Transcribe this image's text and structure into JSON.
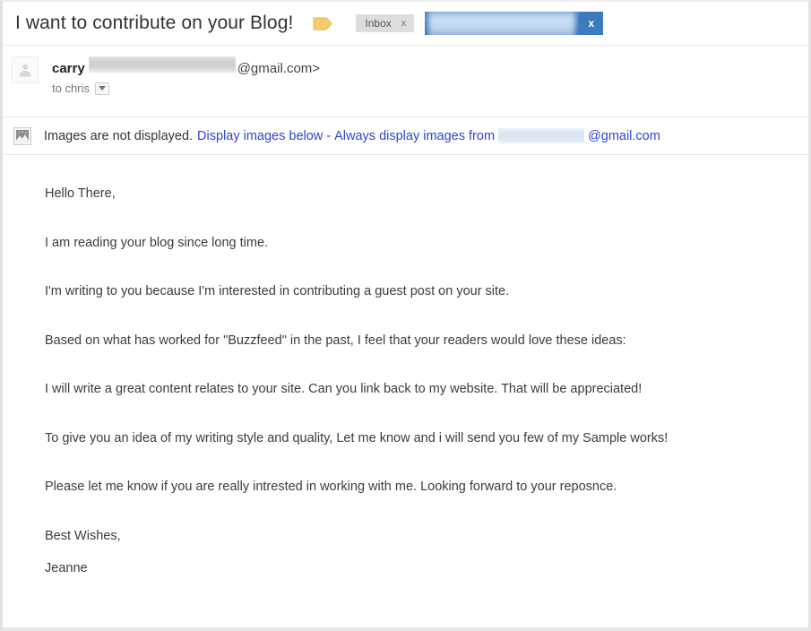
{
  "window": {
    "type": "email-message-view"
  },
  "colors": {
    "link_blue": "#2a47cf",
    "chip_blue": "#3d7cbc",
    "label_yellow": "#f5ce6b",
    "chip_gray": "#dddddd",
    "body_text": "#3c3c3c"
  },
  "header": {
    "subject": "I want to contribute on your Blog!",
    "label_icon": "label-tag-icon",
    "tags": [
      {
        "label": "Inbox",
        "remove_label": "x",
        "style": "gray"
      },
      {
        "label": "",
        "remove_label": "x",
        "style": "blue-redacted",
        "redacted": true
      }
    ]
  },
  "sender": {
    "avatar_icon": "user-avatar-icon",
    "name": "carry",
    "email_redacted": true,
    "email_domain": "@gmail.com>",
    "recipient": "to chris",
    "details_caret_icon": "chevron-down-icon"
  },
  "images_notice": {
    "icon": "broken-image-icon",
    "static_text": "Images are not displayed.",
    "display_link": "Display images below",
    "separator": "-",
    "always_link": "Always display images from",
    "address_redacted": true,
    "address_domain": "@gmail.com"
  },
  "body": {
    "paragraphs": [
      "Hello There,",
      "I am reading your blog since long time.",
      "I'm writing to you because I'm interested in contributing a guest post on your site.",
      "Based on what has worked for \"Buzzfeed\" in the past, I feel that your readers would love these ideas:",
      "I will write a great content relates to your site. Can you link back to my website. That will be appreciated!",
      "To give you an idea of my writing style and quality, Let me know and i will send you few of my Sample works!",
      "Please let me know if you are really intrested in working with me. Looking forward to your reposnce.",
      "Best Wishes,",
      "Jeanne"
    ]
  }
}
